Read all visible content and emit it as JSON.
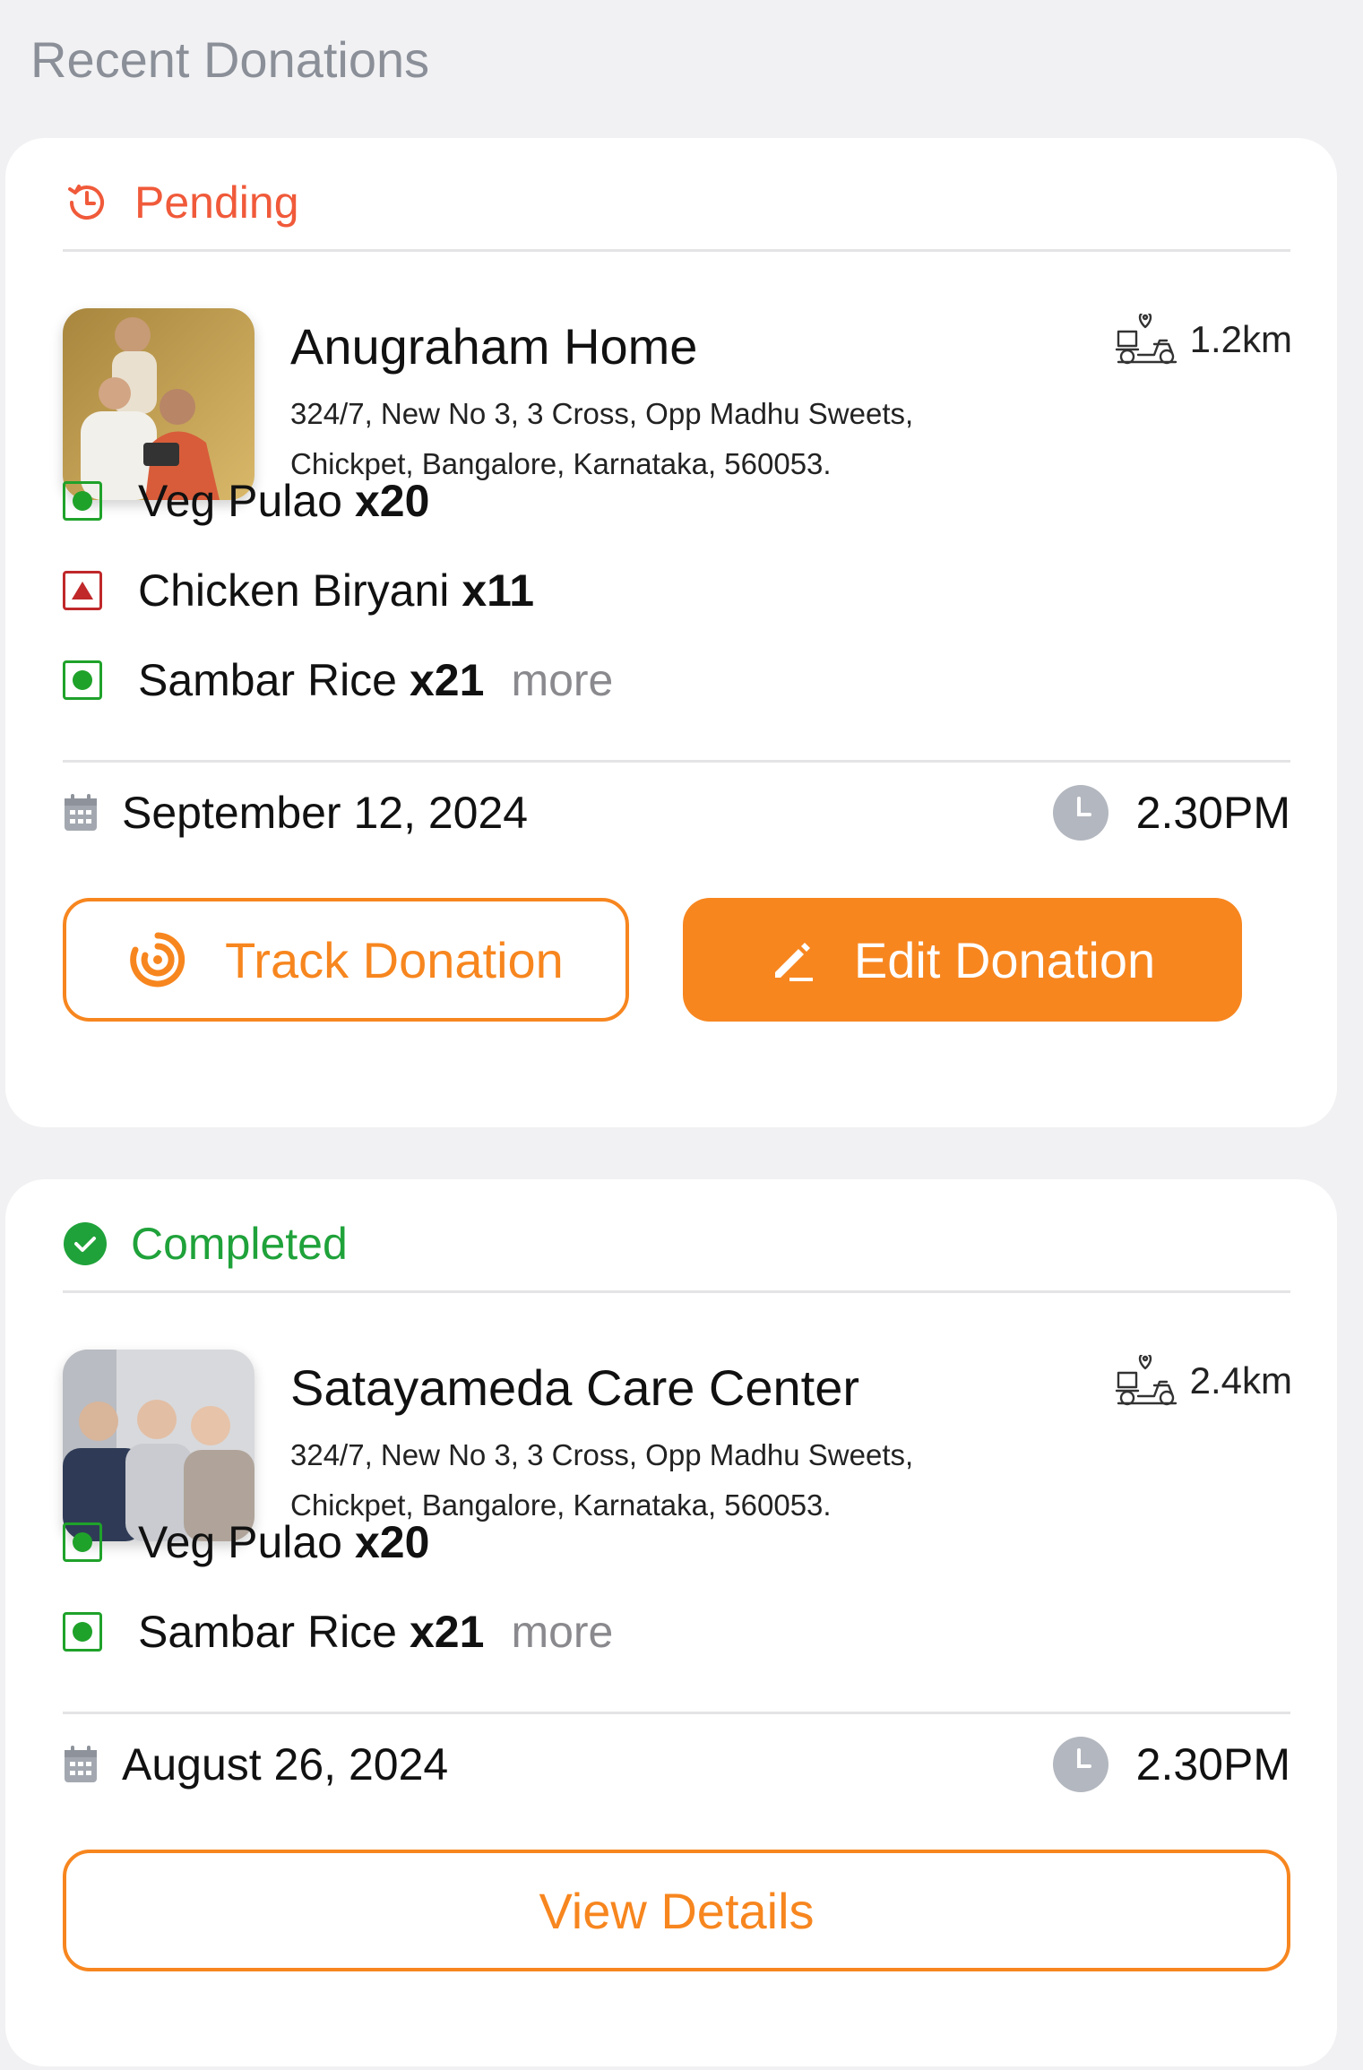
{
  "title": "Recent Donations",
  "donations": [
    {
      "status": "Pending",
      "name": "Anugraham Home",
      "address_line1": "324/7, New No 3, 3 Cross, Opp Madhu Sweets,",
      "address_line2": "Chickpet, Bangalore, Karnataka, 560053.",
      "distance": "1.2km",
      "items": [
        {
          "name": "Veg Pulao",
          "qty": "x20",
          "type": "veg"
        },
        {
          "name": "Chicken Biryani",
          "qty": "x11",
          "type": "non-veg"
        },
        {
          "name": "Sambar Rice",
          "qty": "x21",
          "type": "veg"
        }
      ],
      "more_label": "more",
      "date": "September 12, 2024",
      "time": "2.30PM",
      "track_label": "Track Donation",
      "edit_label": "Edit Donation"
    },
    {
      "status": "Completed",
      "name": "Satayameda Care Center",
      "address_line1": "324/7, New No 3, 3 Cross, Opp Madhu Sweets,",
      "address_line2": "Chickpet, Bangalore, Karnataka, 560053.",
      "distance": "2.4km",
      "items": [
        {
          "name": "Veg Pulao",
          "qty": "x20",
          "type": "veg"
        },
        {
          "name": "Sambar Rice",
          "qty": "x21",
          "type": "veg"
        }
      ],
      "more_label": "more",
      "date": "August 26, 2024",
      "time": "2.30PM",
      "details_label": "View Details"
    }
  ],
  "colors": {
    "accent": "#f7861f",
    "pending": "#f05a3a",
    "completed": "#1fa23a",
    "veg": "#1fa22a",
    "nonveg": "#c0282a"
  }
}
